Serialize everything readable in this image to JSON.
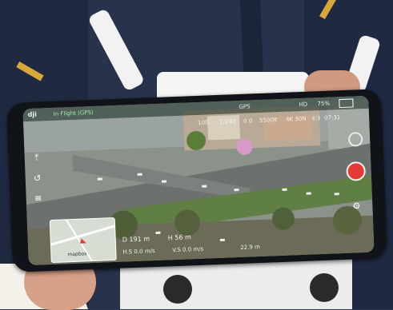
{
  "app": {
    "brand": "dji",
    "mode": "In Flight (GPS)",
    "gps_label": "GPS",
    "hd_label": "HD",
    "battery_percent": "75%"
  },
  "camera": {
    "iso": "100",
    "shutter": "1/240",
    "ev": "0.0",
    "wb": "5500K",
    "resolution": "4K 30N",
    "fps": "4:3",
    "storage": "07:31"
  },
  "telemetry": {
    "distance": "D 191 m",
    "height": "H 56 m",
    "h_speed": "H.S 0.0 m/s",
    "v_speed": "V.S 0.0 m/s",
    "altitude": "22.9 m"
  },
  "map": {
    "label": "mapbox"
  },
  "icons": {
    "takeoff": "takeoff-icon",
    "rth": "return-home-icon",
    "menu": "menu-icon",
    "shutter": "shutter-icon",
    "settings": "settings-icon"
  },
  "colors": {
    "status_green": "#34c759",
    "shutter_red": "#e53935"
  }
}
